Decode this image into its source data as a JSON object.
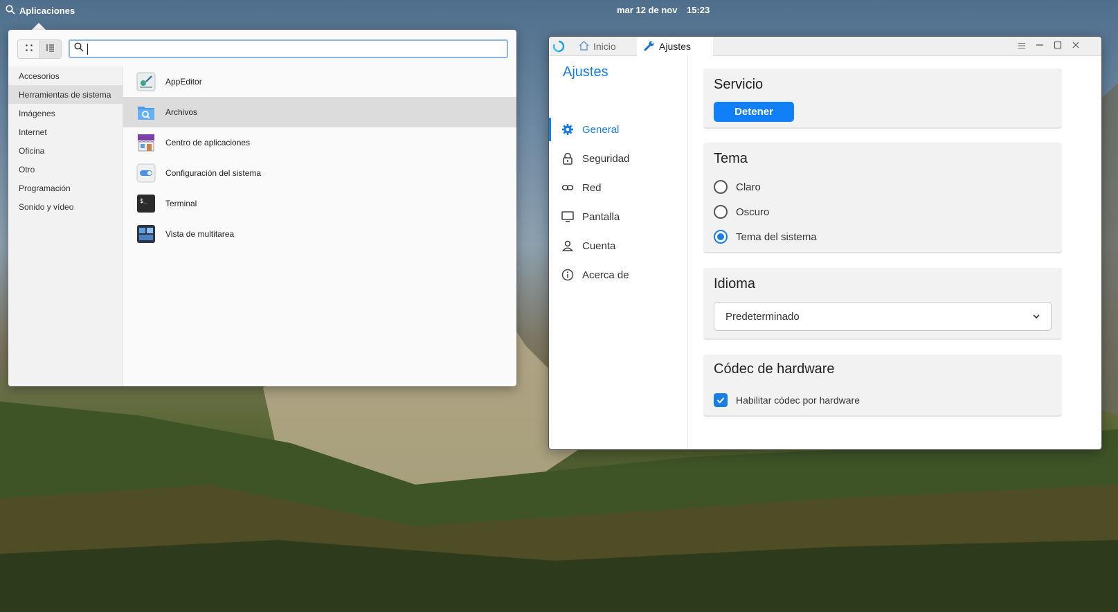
{
  "panel": {
    "applications_label": "Aplicaciones",
    "date": "mar 12 de nov",
    "time": "15:23"
  },
  "launcher": {
    "search": {
      "value": "",
      "placeholder": ""
    },
    "categories": [
      {
        "label": "Accesorios",
        "selected": false
      },
      {
        "label": "Herramientas de sistema",
        "selected": true
      },
      {
        "label": "Imágenes",
        "selected": false
      },
      {
        "label": "Internet",
        "selected": false
      },
      {
        "label": "Oficina",
        "selected": false
      },
      {
        "label": "Otro",
        "selected": false
      },
      {
        "label": "Programación",
        "selected": false
      },
      {
        "label": "Sonido y vídeo",
        "selected": false
      }
    ],
    "apps": [
      {
        "label": "AppEditor",
        "icon": "app-editor-icon",
        "selected": false
      },
      {
        "label": "Archivos",
        "icon": "files-icon",
        "selected": true
      },
      {
        "label": "Centro de aplicaciones",
        "icon": "app-center-icon",
        "selected": false
      },
      {
        "label": "Configuración del sistema",
        "icon": "system-settings-icon",
        "selected": false
      },
      {
        "label": "Terminal",
        "icon": "terminal-icon",
        "selected": false
      },
      {
        "label": "Vista de multitarea",
        "icon": "multitasking-view-icon",
        "selected": false
      }
    ]
  },
  "settings_window": {
    "tabs": [
      {
        "label": "Inicio",
        "icon": "home-icon",
        "active": false
      },
      {
        "label": "Ajustes",
        "icon": "wrench-icon",
        "active": true
      }
    ],
    "sidebar": {
      "title": "Ajustes",
      "items": [
        {
          "label": "General",
          "icon": "gear-icon",
          "selected": true
        },
        {
          "label": "Seguridad",
          "icon": "lock-icon",
          "selected": false
        },
        {
          "label": "Red",
          "icon": "link-icon",
          "selected": false
        },
        {
          "label": "Pantalla",
          "icon": "monitor-icon",
          "selected": false
        },
        {
          "label": "Cuenta",
          "icon": "user-icon",
          "selected": false
        },
        {
          "label": "Acerca de",
          "icon": "info-icon",
          "selected": false
        }
      ]
    },
    "service": {
      "title": "Servicio",
      "button_label": "Detener"
    },
    "theme": {
      "title": "Tema",
      "options": [
        {
          "label": "Claro",
          "selected": false
        },
        {
          "label": "Oscuro",
          "selected": false
        },
        {
          "label": "Tema del sistema",
          "selected": true
        }
      ]
    },
    "language": {
      "title": "Idioma",
      "selected": "Predeterminado"
    },
    "codec": {
      "title": "Códec de hardware",
      "checkbox_label": "Habilitar códec por hardware",
      "checked": true
    }
  },
  "colors": {
    "accent": "#1a7ee0",
    "button": "#1180f8"
  }
}
